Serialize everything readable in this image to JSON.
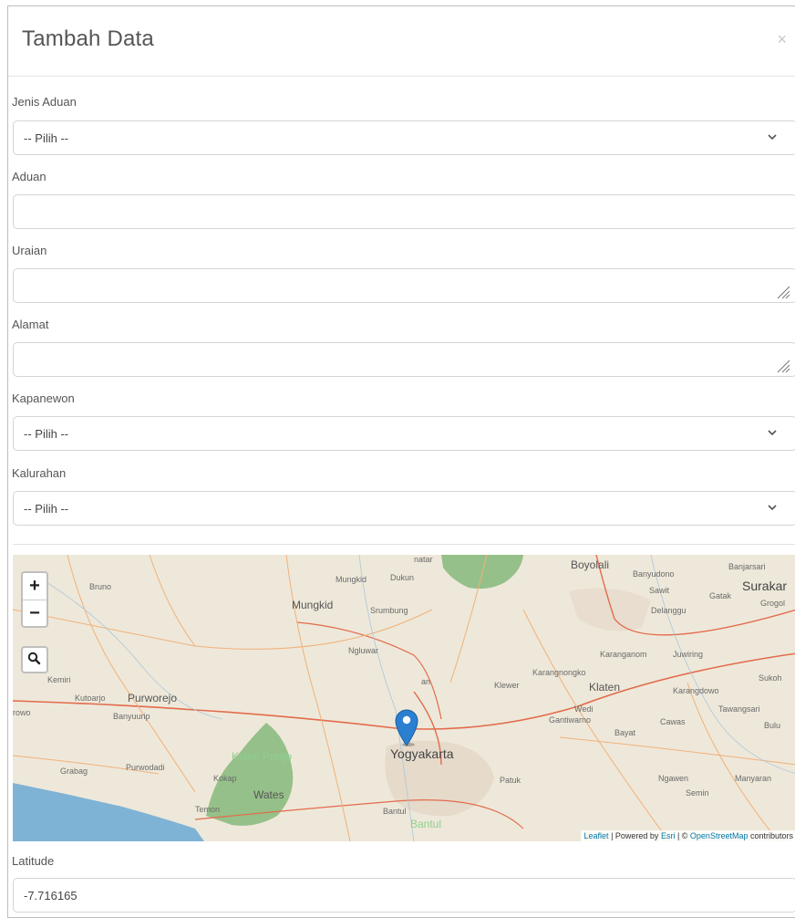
{
  "modal": {
    "title": "Tambah Data",
    "close": "×"
  },
  "form": {
    "jenis_aduan": {
      "label": "Jenis Aduan",
      "value": "-- Pilih --"
    },
    "aduan": {
      "label": "Aduan",
      "value": ""
    },
    "uraian": {
      "label": "Uraian",
      "value": ""
    },
    "alamat": {
      "label": "Alamat",
      "value": ""
    },
    "kapanewon": {
      "label": "Kapanewon",
      "value": "-- Pilih --"
    },
    "kalurahan": {
      "label": "Kalurahan",
      "value": "-- Pilih --"
    },
    "latitude": {
      "label": "Latitude",
      "value": "-7.716165"
    }
  },
  "map": {
    "zoom_in": "+",
    "zoom_out": "−",
    "places": {
      "boyolali": "Boyolali",
      "banyudono": "Banyudono",
      "banjarsari": "Banjarsari",
      "surakarta": "Surakar",
      "sawit": "Sawit",
      "gatak": "Gatak",
      "grogol": "Grogol",
      "delanggu": "Delanggu",
      "mungkid": "Mungkid",
      "mungkid_small": "Mungkid",
      "dukun": "Dukun",
      "srumbung": "Srumbung",
      "bruno": "Bruno",
      "ngluwar": "Ngluwar",
      "karanganom": "Karanganom",
      "juwiring": "Juwiring",
      "karangnongko": "Karangnongko",
      "klewer": "Klewer",
      "klaten": "Klaten",
      "karangdowo": "Karangdowo",
      "sukoharjo": "Sukoh",
      "kemiri": "Kemiri",
      "kutoarjo": "Kutoarjo",
      "purworejo": "Purworejo",
      "wedi": "Wedi",
      "tawangsari": "Tawangsari",
      "rowo": "rowo",
      "banyuurip": "Banyuurip",
      "gantiwarno": "Gantiwarno",
      "cawas": "Cawas",
      "bulu": "Bulu",
      "bayat": "Bayat",
      "kulon_progo": "Kulon Progo",
      "yogyakarta": "Yogyakarta",
      "grabag": "Grabag",
      "purwodadi": "Purwodadi",
      "kokap": "Kokap",
      "wates": "Wates",
      "patuk": "Patuk",
      "ngawen": "Ngawen",
      "manyaran": "Manyaran",
      "semin": "Semin",
      "temon": "Temon",
      "bantul": "Bantul",
      "bantul2": "Bantul",
      "sleman": "an",
      "natar": "natar"
    },
    "attribution": {
      "leaflet": "Leaflet",
      "sep1": " | Powered by ",
      "esri": "Esri",
      "sep2": " | © ",
      "osm": "OpenStreetMap",
      "tail": " contributors"
    },
    "colors": {
      "land": "#eee8da",
      "sea": "#7fb3d5",
      "forest": "#86b97a",
      "roads": "#f0b17a",
      "pin": "#2b7fd1"
    }
  }
}
